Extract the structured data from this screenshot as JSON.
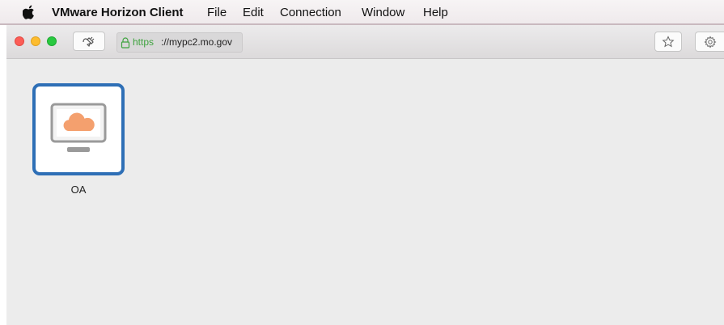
{
  "menubar": {
    "apple_icon": "apple-logo-icon",
    "app_name": "VMware Horizon Client",
    "items": [
      "File",
      "Edit",
      "Connection",
      "Window",
      "Help"
    ]
  },
  "toolbar": {
    "plug_icon": "plug-icon",
    "url_scheme": "https",
    "url_rest": "://mypc2.mo.gov",
    "lock_icon": "lock-icon",
    "star_icon": "star-icon",
    "gear_icon": "gear-icon"
  },
  "desktops": [
    {
      "label": "OA",
      "icon": "desktop-monitor-cloud-icon"
    }
  ],
  "colors": {
    "selection_border": "#2e6fb6",
    "url_scheme": "#3fa33f",
    "cloud": "#f4a06e"
  }
}
